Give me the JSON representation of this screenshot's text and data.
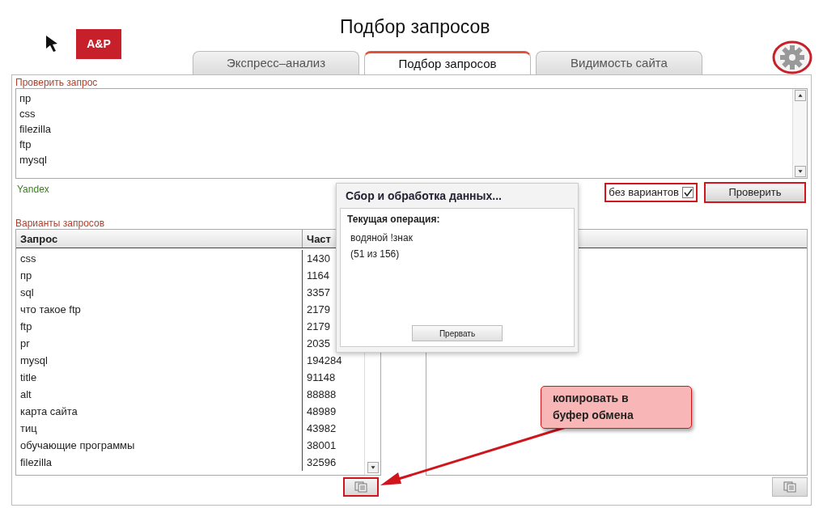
{
  "title": "Подбор запросов",
  "logo": "A&P",
  "tabs": [
    {
      "label": "Экспресс–анализ",
      "selected": false
    },
    {
      "label": "Подбор запросов",
      "selected": true
    },
    {
      "label": "Видимость сайта",
      "selected": false
    }
  ],
  "check_query": {
    "label": "Проверить запрос",
    "lines": [
      "пр",
      "css",
      "filezilla",
      "ftp",
      "mysql"
    ]
  },
  "engine": "Yandex",
  "no_variants": {
    "label": "без вариантов",
    "checked": true,
    "highlighted": true
  },
  "check_button": {
    "label": "Проверить",
    "highlighted": true
  },
  "variants": {
    "label": "Варианты запросов",
    "columns": [
      "Запрос",
      "Част"
    ],
    "rows": [
      [
        "css",
        "1430"
      ],
      [
        "пр",
        "1164"
      ],
      [
        "sql",
        "3357"
      ],
      [
        "что такое ftp",
        "2179"
      ],
      [
        "ftp",
        "2179"
      ],
      [
        "pr",
        "2035"
      ],
      [
        "mysql",
        "194284"
      ],
      [
        "title",
        "91148"
      ],
      [
        "alt",
        "88888"
      ],
      [
        "карта сайта",
        "48989"
      ],
      [
        "тиц",
        "43982"
      ],
      [
        "обучающие программы",
        "38001"
      ],
      [
        "filezilla",
        "32596"
      ]
    ]
  },
  "copy_buttons": [
    {
      "highlighted": true
    },
    {
      "highlighted": false
    }
  ],
  "progress_dialog": {
    "title": "Сбор и обработка данных...",
    "operation_label": "Текущая операция:",
    "operation": "водяной !знак",
    "progress": "(51 из 156)",
    "cancel_button": "Прервать"
  },
  "callout": "копировать в\nбуфер обмена"
}
